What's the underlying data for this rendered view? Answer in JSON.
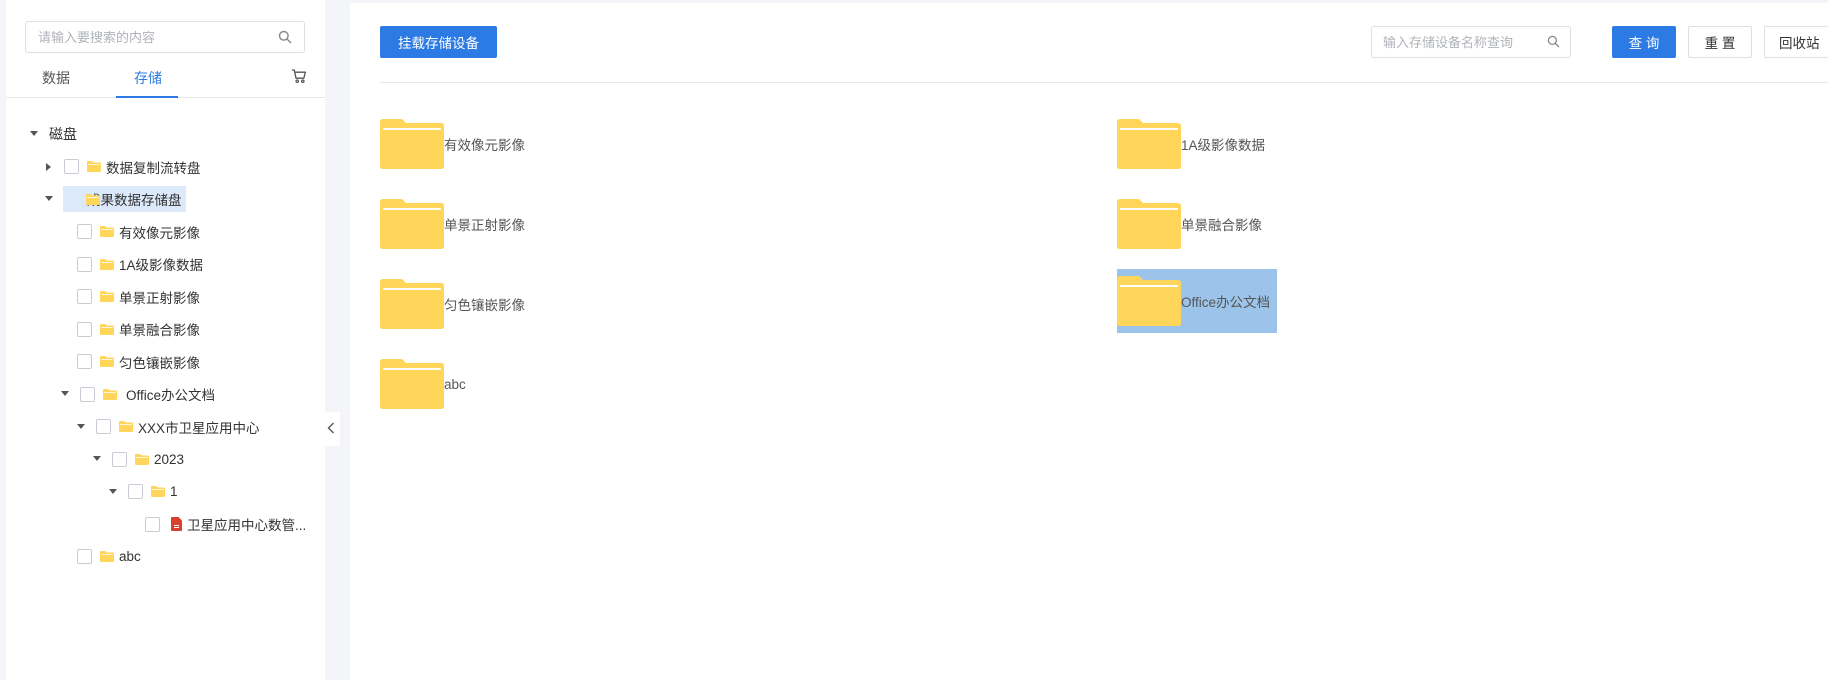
{
  "sidebar": {
    "search_placeholder": "请输入要搜索的内容",
    "tabs": {
      "data": "数据",
      "storage": "存储",
      "active": "storage"
    },
    "tree": {
      "root": "磁盘",
      "n1": "数据复制流转盘",
      "n2": "成果数据存储盘",
      "n2_1": "有效像元影像",
      "n2_2": "1A级影像数据",
      "n2_3": "单景正射影像",
      "n2_4": "单景融合影像",
      "n2_5": "匀色镶嵌影像",
      "n2_6": "Office办公文档",
      "n2_6_1": "XXX市卫星应用中心",
      "n2_6_1_1": "2023",
      "n2_6_1_1_1": "1",
      "n2_6_1_1_1_file": "卫星应用中心数管...",
      "n2_7": "abc"
    }
  },
  "toolbar": {
    "mount_label": "挂载存储设备",
    "filter_placeholder": "输入存储设备名称查询",
    "query_label": "查 询",
    "reset_label": "重 置",
    "recycle_label": "回收站"
  },
  "grid": {
    "f1": "有效像元影像",
    "f2": "1A级影像数据",
    "f3": "单景正射影像",
    "f4": "单景融合影像",
    "f5": "匀色镶嵌影像",
    "f6": "Office办公文档",
    "f7": "abc",
    "selected": "Office办公文档"
  },
  "colors": {
    "accent": "#2c7be5",
    "folder": "#ffd55a",
    "selected_bg": "#9cc3e9",
    "tree_highlight": "#dbe9fa",
    "pdf": "#d9412f"
  }
}
